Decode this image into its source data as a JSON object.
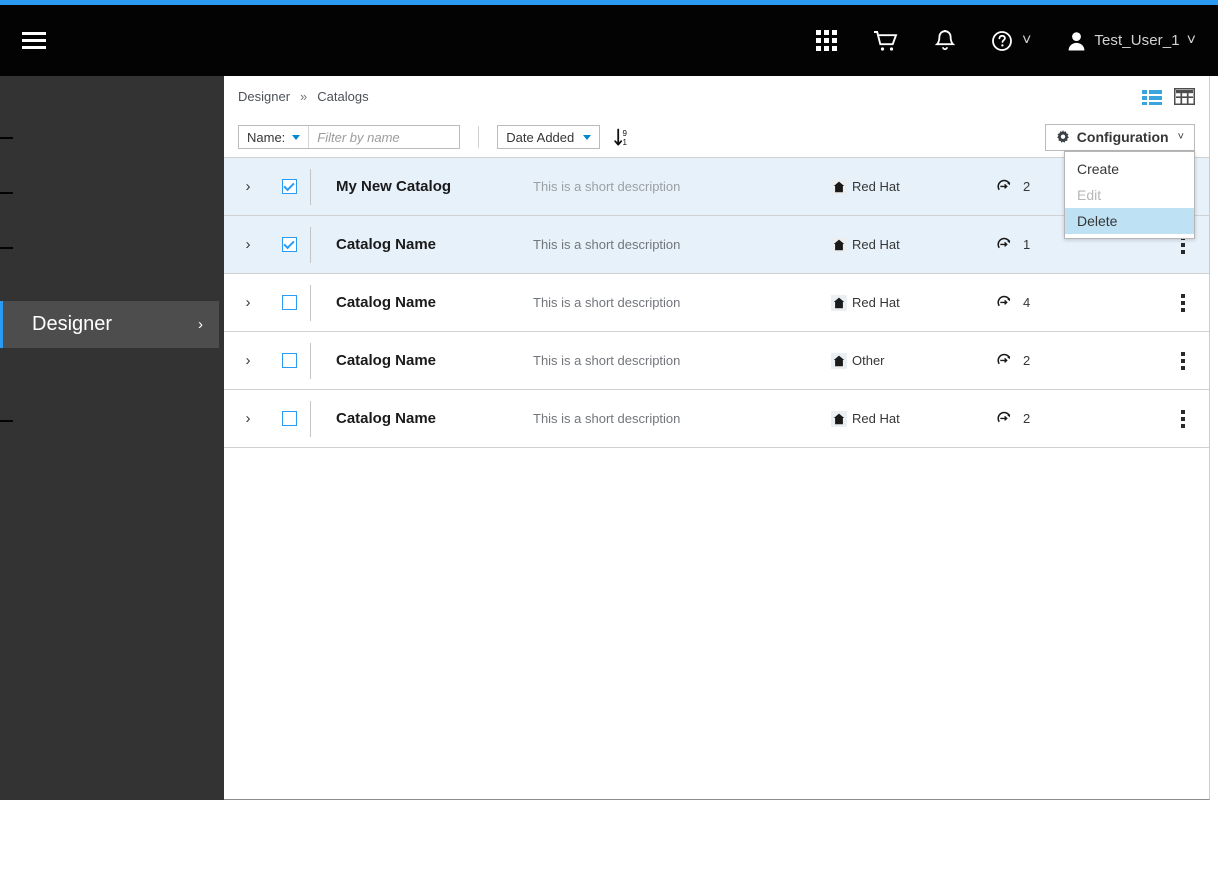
{
  "masthead": {
    "hamburger": "menu-icon",
    "icons": [
      {
        "name": "app-launcher-icon",
        "title": "Applications"
      },
      {
        "name": "cart-icon",
        "title": "Cart"
      },
      {
        "name": "bell-icon",
        "title": "Notifications"
      },
      {
        "name": "help-icon",
        "title": "Help"
      }
    ],
    "user": {
      "name": "Test_User_1",
      "avatar": "user-icon",
      "caret": "˅"
    }
  },
  "sidebar": {
    "active_item": {
      "label": "Designer",
      "chevron": "›"
    },
    "tick_offsets": [
      61,
      116,
      171,
      344
    ]
  },
  "breadcrumb": {
    "items": [
      "Designer",
      "Catalogs"
    ],
    "separator": "»"
  },
  "view_toggles": {
    "list_view": "list-view-icon",
    "table_view": "table-view-icon",
    "active": "list_view"
  },
  "toolbar": {
    "filter_field_label": "Name:",
    "filter_placeholder": "Filter by name",
    "filter_value": "",
    "sort_field_label": "Date Added",
    "sort_direction_icon": "sort-descending-numeric-icon",
    "sort_direction_glyph": {
      "top": "9",
      "bottom": "1"
    },
    "configuration": {
      "label": "Configuration",
      "gear_icon": "gear-icon",
      "chevron": "˅",
      "open": true,
      "menu": [
        {
          "label": "Create",
          "state": "normal"
        },
        {
          "label": "Edit",
          "state": "disabled"
        },
        {
          "label": "Delete",
          "state": "highlighted"
        }
      ]
    }
  },
  "list": {
    "rows": [
      {
        "expand": "›",
        "checked": true,
        "selected": true,
        "name": "My New Catalog",
        "description": "This is a short description",
        "vendor": "Red Hat",
        "vendor_icon": "building-icon",
        "count_icon": "process-icon",
        "count": "2",
        "kebab_visible": false
      },
      {
        "expand": "›",
        "checked": true,
        "selected": true,
        "name": "Catalog Name",
        "description": "This is a short description",
        "vendor": "Red Hat",
        "vendor_icon": "building-icon",
        "count_icon": "process-icon",
        "count": "1",
        "kebab_visible": true
      },
      {
        "expand": "›",
        "checked": false,
        "selected": false,
        "name": "Catalog Name",
        "description": "This is a short description",
        "vendor": "Red Hat",
        "vendor_icon": "building-icon",
        "count_icon": "process-icon",
        "count": "4",
        "kebab_visible": true
      },
      {
        "expand": "›",
        "checked": false,
        "selected": false,
        "name": "Catalog Name",
        "description": "This is a short description",
        "vendor": "Other",
        "vendor_icon": "building-icon",
        "count_icon": "process-icon",
        "count": "2",
        "kebab_visible": true
      },
      {
        "expand": "›",
        "checked": false,
        "selected": false,
        "name": "Catalog Name",
        "description": "This is a short description",
        "vendor": "Red Hat",
        "vendor_icon": "building-icon",
        "count_icon": "process-icon",
        "count": "2",
        "kebab_visible": true
      }
    ]
  },
  "colors": {
    "accent_blue": "#2b9af3",
    "masthead_black": "#030303",
    "sidebar_dark": "#333333",
    "row_selected": "#e7f1fa",
    "menu_highlight": "#bee1f4"
  }
}
